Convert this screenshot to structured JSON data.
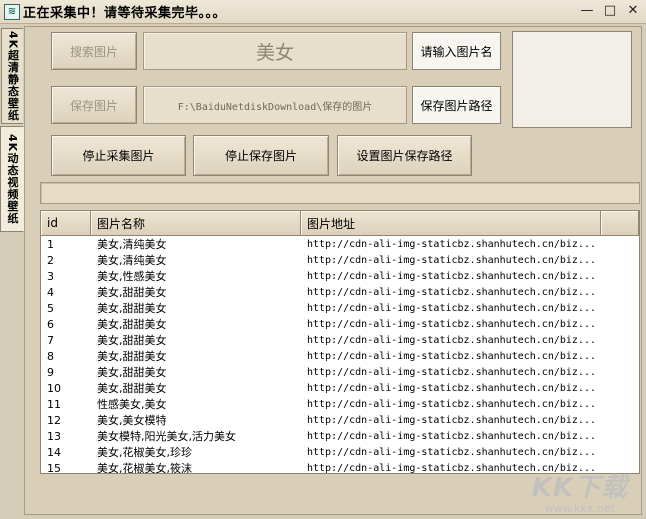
{
  "window": {
    "title": "正在采集中！请等待采集完毕。。。",
    "icon_glyph": "≋",
    "minimize": "—",
    "maximize": "□",
    "close": "✕"
  },
  "side_tabs": [
    {
      "label": "4K超清静态壁纸",
      "active": false
    },
    {
      "label": "4K动态视频壁纸",
      "active": true
    }
  ],
  "controls": {
    "search_button": "搜索图片",
    "keyword_value": "美女",
    "input_name_button": "请输入图片名",
    "save_button": "保存图片",
    "save_path_value": "F:\\BaiduNetdiskDownload\\保存的图片",
    "save_path_button": "保存图片路径",
    "stop_collect_button": "停止采集图片",
    "stop_save_button": "停止保存图片",
    "set_save_path_button": "设置图片保存路径"
  },
  "progress": {
    "value": 0
  },
  "table": {
    "columns": [
      "id",
      "图片名称",
      "图片地址"
    ],
    "rows": [
      {
        "id": "1",
        "name": "美女,清纯美女",
        "url": "http://cdn-ali-img-staticbz.shanhutech.cn/biz..."
      },
      {
        "id": "2",
        "name": "美女,清纯美女",
        "url": "http://cdn-ali-img-staticbz.shanhutech.cn/biz..."
      },
      {
        "id": "3",
        "name": "美女,性感美女",
        "url": "http://cdn-ali-img-staticbz.shanhutech.cn/biz..."
      },
      {
        "id": "4",
        "name": "美女,甜甜美女",
        "url": "http://cdn-ali-img-staticbz.shanhutech.cn/biz..."
      },
      {
        "id": "5",
        "name": "美女,甜甜美女",
        "url": "http://cdn-ali-img-staticbz.shanhutech.cn/biz..."
      },
      {
        "id": "6",
        "name": "美女,甜甜美女",
        "url": "http://cdn-ali-img-staticbz.shanhutech.cn/biz..."
      },
      {
        "id": "7",
        "name": "美女,甜甜美女",
        "url": "http://cdn-ali-img-staticbz.shanhutech.cn/biz..."
      },
      {
        "id": "8",
        "name": "美女,甜甜美女",
        "url": "http://cdn-ali-img-staticbz.shanhutech.cn/biz..."
      },
      {
        "id": "9",
        "name": "美女,甜甜美女",
        "url": "http://cdn-ali-img-staticbz.shanhutech.cn/biz..."
      },
      {
        "id": "10",
        "name": "美女,甜甜美女",
        "url": "http://cdn-ali-img-staticbz.shanhutech.cn/biz..."
      },
      {
        "id": "11",
        "name": "性感美女,美女",
        "url": "http://cdn-ali-img-staticbz.shanhutech.cn/biz..."
      },
      {
        "id": "12",
        "name": "美女,美女模特",
        "url": "http://cdn-ali-img-staticbz.shanhutech.cn/biz..."
      },
      {
        "id": "13",
        "name": "美女模特,阳光美女,活力美女",
        "url": "http://cdn-ali-img-staticbz.shanhutech.cn/biz..."
      },
      {
        "id": "14",
        "name": "美女,花椒美女,珍珍",
        "url": "http://cdn-ali-img-staticbz.shanhutech.cn/biz..."
      },
      {
        "id": "15",
        "name": "美女,花椒美女,筱沫",
        "url": "http://cdn-ali-img-staticbz.shanhutech.cn/biz..."
      }
    ]
  },
  "watermark": {
    "main": "KK下载",
    "sub": "www.kkx.net"
  },
  "colors": {
    "background": "#d6cdb8",
    "button_face": "#e6dec9",
    "table_bg": "#ffffff"
  }
}
